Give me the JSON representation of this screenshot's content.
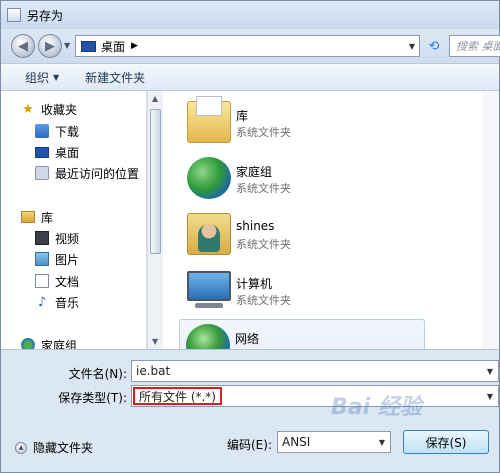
{
  "window": {
    "title": "另存为"
  },
  "address": {
    "location": "桌面",
    "search_placeholder": "搜索 桌面"
  },
  "toolbar": {
    "organize": "组织",
    "new_folder": "新建文件夹"
  },
  "nav": {
    "favorites": "收藏夹",
    "downloads": "下载",
    "desktop": "桌面",
    "recent": "最近访问的位置",
    "libraries": "库",
    "videos": "视频",
    "pictures": "图片",
    "documents": "文档",
    "music": "音乐",
    "homegroup": "家庭组"
  },
  "files": [
    {
      "name": "库",
      "type": "系统文件夹"
    },
    {
      "name": "家庭组",
      "type": "系统文件夹"
    },
    {
      "name": "shines",
      "type": "系统文件夹"
    },
    {
      "name": "计算机",
      "type": "系统文件夹"
    },
    {
      "name": "网络",
      "type": ""
    }
  ],
  "form": {
    "filename_label": "文件名(N):",
    "filename_value": "ie.bat",
    "savetype_label": "保存类型(T):",
    "savetype_value": "所有文件 (*.*)",
    "hide_folders": "隐藏文件夹",
    "encoding_label": "编码(E):",
    "encoding_value": "ANSI",
    "save_button": "保存(S)"
  },
  "watermark": "Bai 经验",
  "colors": {
    "highlight_border": "#d41e24",
    "accent": "#1f54a8"
  }
}
